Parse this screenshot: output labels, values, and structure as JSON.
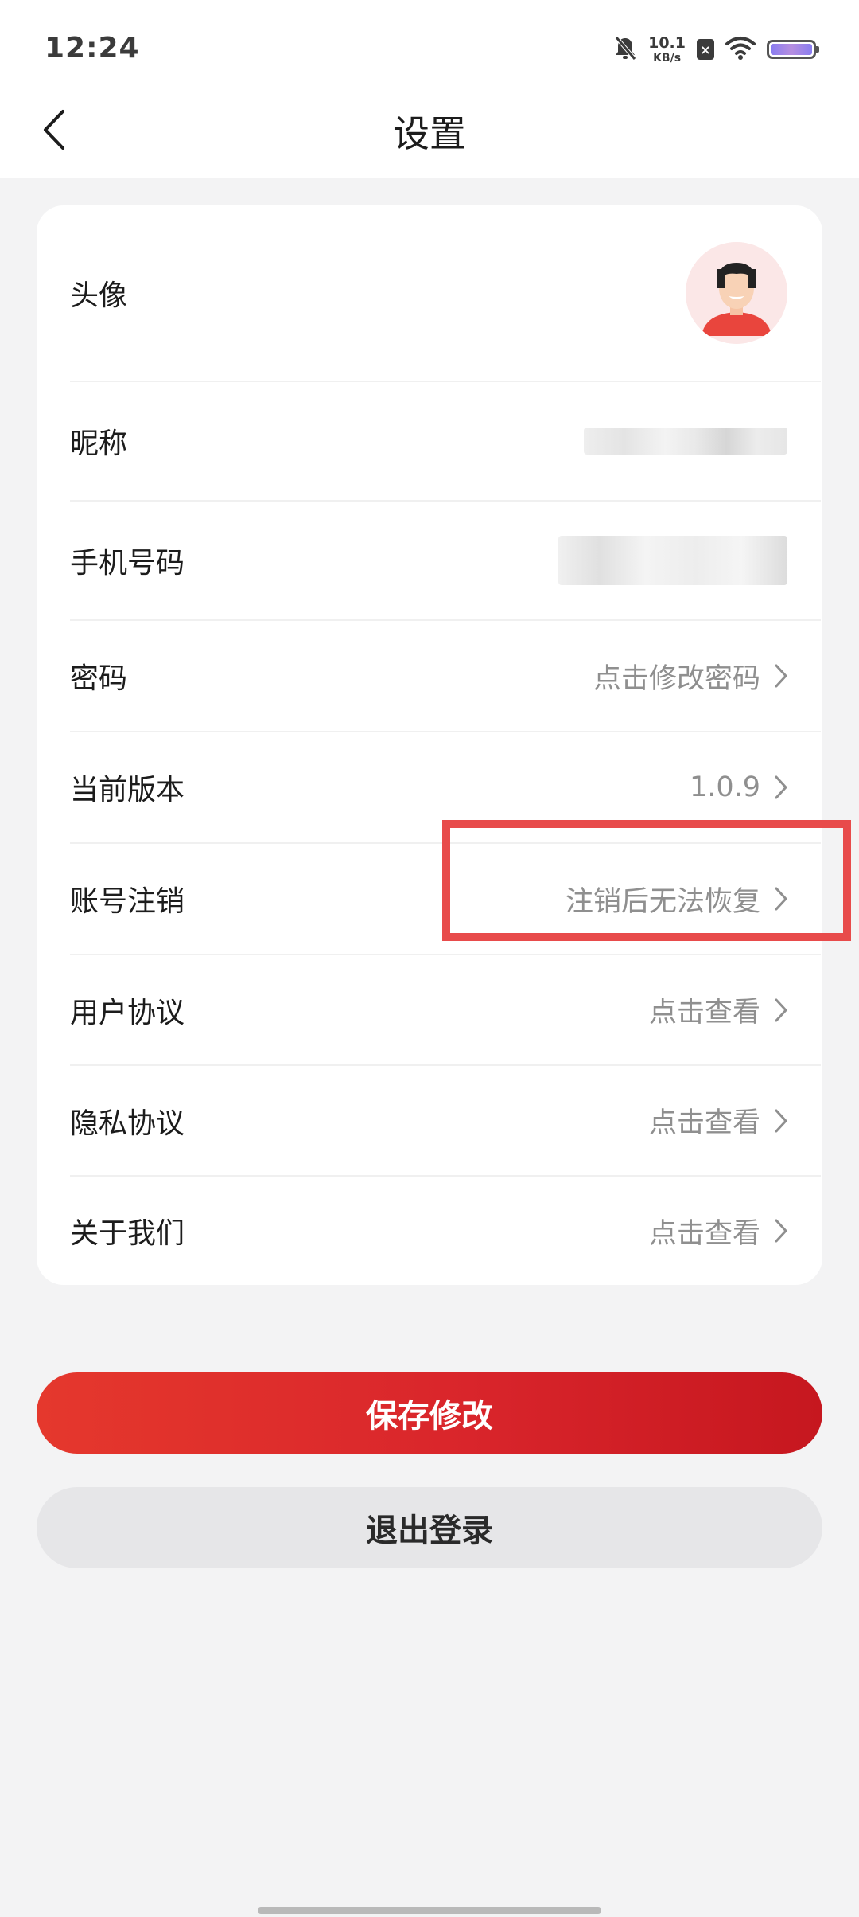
{
  "status_bar": {
    "time": "12:24",
    "net_speed_value": "10.1",
    "net_speed_unit": "KB/s",
    "sim_badge": "×",
    "icons": [
      "mute-bell-icon",
      "sim-icon",
      "wifi-icon",
      "battery-icon"
    ]
  },
  "header": {
    "title": "设置",
    "back_icon": "chevron-left-icon"
  },
  "settings": {
    "avatar_label": "头像",
    "nickname_label": "昵称",
    "phone_label": "手机号码",
    "password_label": "密码",
    "password_value": "点击修改密码",
    "version_label": "当前版本",
    "version_value": "1.0.9",
    "account_cancel_label": "账号注销",
    "account_cancel_value": "注销后无法恢复",
    "user_agreement_label": "用户协议",
    "user_agreement_value": "点击查看",
    "privacy_label": "隐私协议",
    "privacy_value": "点击查看",
    "about_label": "关于我们",
    "about_value": "点击查看"
  },
  "buttons": {
    "save": "保存修改",
    "logout": "退出登录"
  },
  "colors": {
    "primary_red": "#d9252b",
    "highlight_red": "#e84b4b",
    "secondary_gray": "#e6e6e8",
    "page_bg": "#f3f3f4"
  }
}
